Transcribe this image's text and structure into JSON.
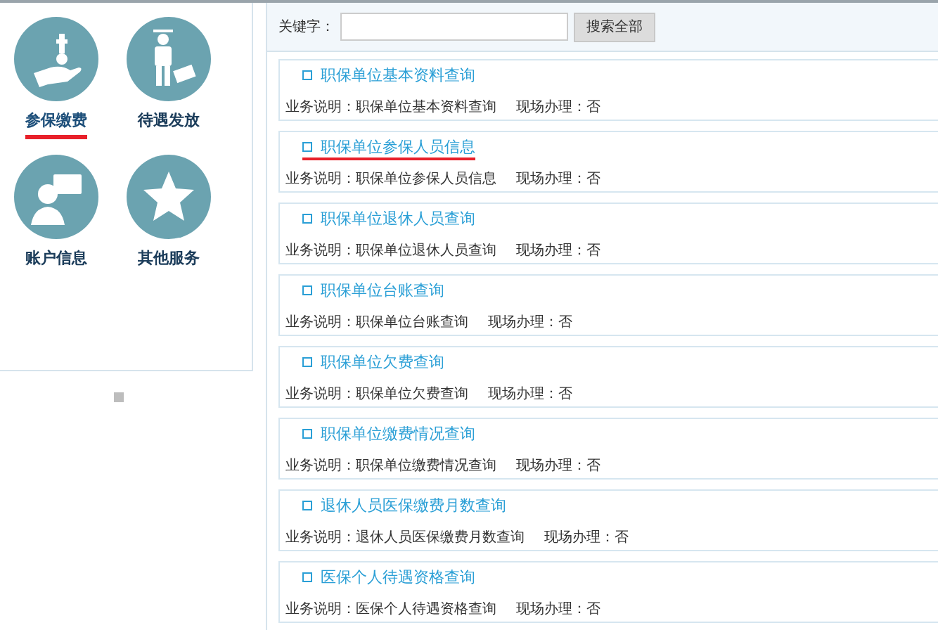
{
  "categories": [
    {
      "label": "参保缴费",
      "kind": "payment",
      "selected": true
    },
    {
      "label": "待遇发放",
      "kind": "benefit",
      "selected": false
    },
    {
      "label": "账户信息",
      "kind": "account",
      "selected": false
    },
    {
      "label": "其他服务",
      "kind": "star",
      "selected": false
    }
  ],
  "search": {
    "label": "关键字：",
    "button": "搜索全部"
  },
  "services": [
    {
      "title": "职保单位基本资料查询",
      "description": "业务说明：职保单位基本资料查询",
      "onsite": "现场办理：否",
      "highlighted": false
    },
    {
      "title": "职保单位参保人员信息",
      "description": "业务说明：职保单位参保人员信息",
      "onsite": "现场办理：否",
      "highlighted": true
    },
    {
      "title": "职保单位退休人员查询",
      "description": "业务说明：职保单位退休人员查询",
      "onsite": "现场办理：否",
      "highlighted": false
    },
    {
      "title": "职保单位台账查询",
      "description": "业务说明：职保单位台账查询",
      "onsite": "现场办理：否",
      "highlighted": false
    },
    {
      "title": "职保单位欠费查询",
      "description": "业务说明：职保单位欠费查询",
      "onsite": "现场办理：否",
      "highlighted": false
    },
    {
      "title": "职保单位缴费情况查询",
      "description": "业务说明：职保单位缴费情况查询",
      "onsite": "现场办理：否",
      "highlighted": false
    },
    {
      "title": "退休人员医保缴费月数查询",
      "description": "业务说明：退休人员医保缴费月数查询",
      "onsite": "现场办理：否",
      "highlighted": false
    },
    {
      "title": "医保个人待遇资格查询",
      "description": "业务说明：医保个人待遇资格查询",
      "onsite": "现场办理：否",
      "highlighted": false
    }
  ]
}
